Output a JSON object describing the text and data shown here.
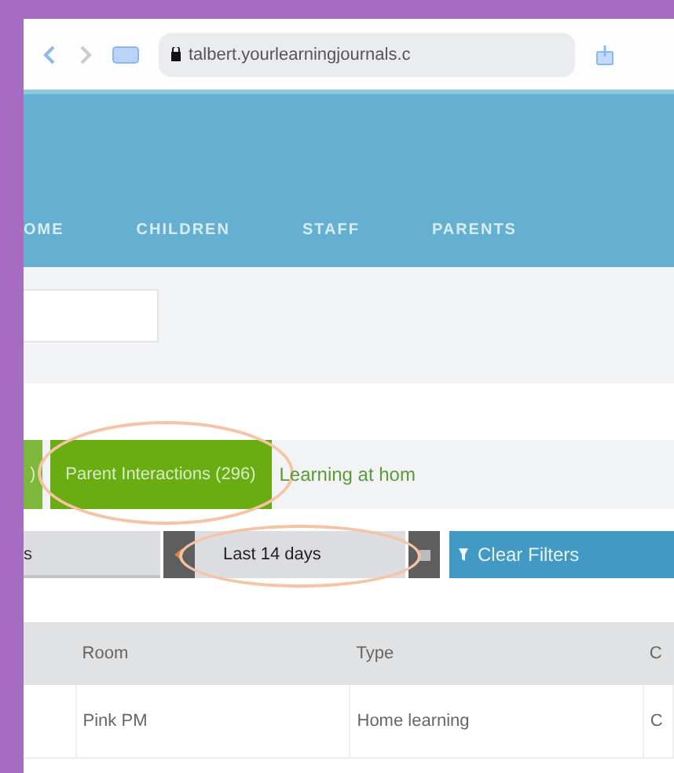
{
  "browser": {
    "url": "talbert.yourlearningjournals.c"
  },
  "nav": [
    {
      "label": "OME"
    },
    {
      "label": "CHILDREN"
    },
    {
      "label": "STAFF"
    },
    {
      "label": "PARENTS"
    }
  ],
  "tabs": [
    {
      "label": ")",
      "selected": false,
      "highlighted": false,
      "kind": "button"
    },
    {
      "label": "Parent Interactions (296)",
      "selected": true,
      "highlighted": true,
      "kind": "button"
    },
    {
      "label": "Learning at hom",
      "selected": false,
      "highlighted": false,
      "kind": "link"
    }
  ],
  "filters": {
    "select_value": "s",
    "date_range": "Last 14 days",
    "date_highlighted": true,
    "clear": "Clear Filters"
  },
  "table": {
    "columns": [
      "",
      "Room",
      "Type",
      "C"
    ],
    "rows": [
      [
        "",
        "Pink PM",
        "Home learning",
        "C"
      ]
    ]
  }
}
